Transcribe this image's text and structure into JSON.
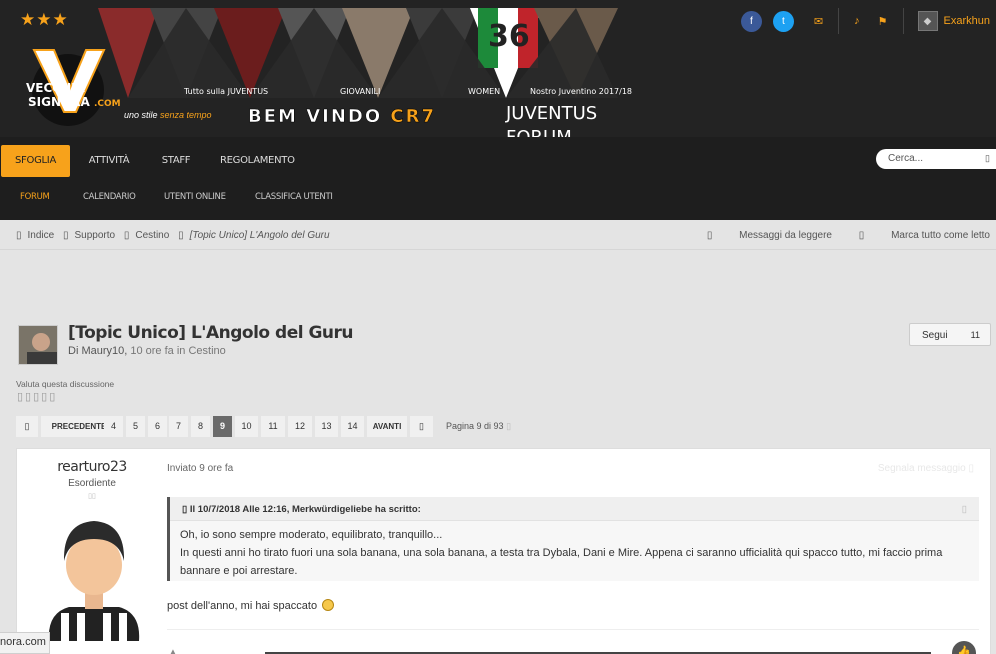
{
  "header": {
    "stars": "★★★",
    "logo_text": [
      "VECCHIA",
      "SIGNORA",
      ".COM"
    ],
    "banner_labels": [
      "Tutto sulla JUVENTUS",
      "GIOVANILI",
      "WOMEN",
      "Nostro Juventino 2017/18"
    ],
    "badge_number": "36",
    "tagline_pre": "uno stile ",
    "tagline_em": "senza tempo",
    "welcome_pre": "BEM VINDO ",
    "welcome_em": "CR7",
    "forum_pre": "JUVENTUS",
    "forum_post": "FORUM",
    "username": "Exarkhun"
  },
  "nav": {
    "tabs": [
      "SFOGLIA",
      "ATTIVITÀ",
      "STAFF",
      "REGOLAMENTO"
    ],
    "sub": [
      "FORUM",
      "CALENDARIO",
      "UTENTI ONLINE",
      "CLASSIFICA UTENTI"
    ],
    "search_placeholder": "Cerca..."
  },
  "breadcrumb": {
    "items": [
      "Indice",
      "Supporto",
      "Cestino",
      "[Topic Unico] L'Angolo del Guru"
    ],
    "unread": "Messaggi da leggere",
    "mark_read": "Marca tutto come letto"
  },
  "topic": {
    "title": "[Topic Unico] L'Angolo del Guru",
    "by": "Di Maury10,",
    "when": " 10 ore fa in Cestino",
    "follow_label": "Segui",
    "follow_count": "11",
    "rate_label": "Valuta questa discussione"
  },
  "pagination": {
    "prev": "PRECEDENTE",
    "pages": [
      "4",
      "5",
      "6",
      "7",
      "8",
      "9",
      "10",
      "11",
      "12",
      "13",
      "14"
    ],
    "current": "9",
    "next": "AVANTI",
    "info": "Pagina 9 di 93"
  },
  "post": {
    "author": "rearturo23",
    "rank": "Esordiente",
    "date": "Inviato 9 ore fa",
    "report": "Segnala messaggio",
    "quote_head": "Il 10/7/2018 Alle 12:16, Merkwürdigeliebe ha scritto:",
    "quote_line1": "Oh, io sono sempre moderato, equilibrato, tranquillo...",
    "quote_line2": "In questi anni ho tirato fuori una sola banana, una sola banana, a testa tra Dybala, Dani e Mire. Appena ci saranno ufficialità qui spacco tutto, mi faccio prima",
    "quote_line3": "bannare e poi arrestare.",
    "text": "post dell'anno, mi hai spaccato"
  },
  "statusbar": {
    "url": "nora.com"
  },
  "colors": {
    "accent": "#f7a21b",
    "header_bg": "#232323",
    "nav_bg": "#1e1e1e",
    "page_bg": "#e4e4e4"
  },
  "icons": [
    "facebook-icon",
    "twitter-icon",
    "envelope-icon",
    "bell-icon",
    "flag-icon",
    "search-icon",
    "thumbs-up-icon"
  ]
}
